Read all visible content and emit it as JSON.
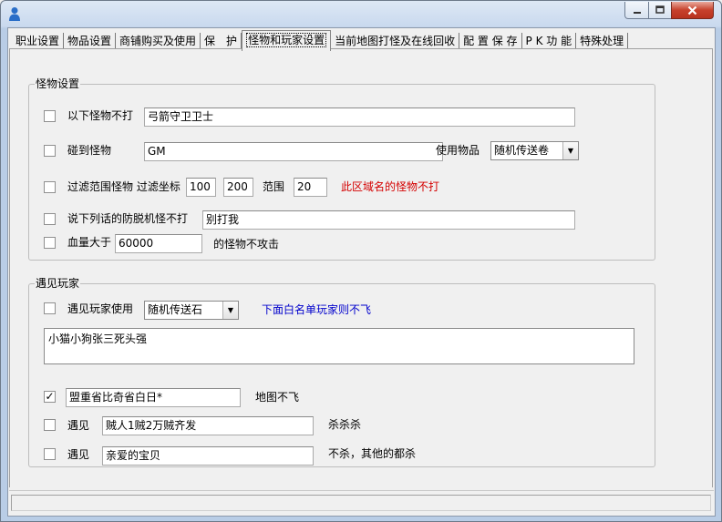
{
  "window": {
    "icons": {
      "app": "person-icon",
      "minimize": "minimize-icon",
      "maximize": "maximize-icon",
      "close": "close-icon"
    }
  },
  "tabs": [
    {
      "label": "职业设置"
    },
    {
      "label": "物品设置"
    },
    {
      "label": "商铺购买及使用"
    },
    {
      "label": "保　护"
    },
    {
      "label": "怪物和玩家设置",
      "active": true
    },
    {
      "label": "当前地图打怪及在线回收"
    },
    {
      "label": "配 置 保 存"
    },
    {
      "label": "P K 功 能"
    },
    {
      "label": "特殊处理"
    }
  ],
  "monster": {
    "title": "怪物设置",
    "no_attack": {
      "checked": false,
      "label": "以下怪物不打",
      "value": "弓箭守卫卫士"
    },
    "meet": {
      "checked": false,
      "label": "碰到怪物",
      "value": "GM",
      "use_label": "使用物品",
      "item": "随机传送卷"
    },
    "range": {
      "checked": false,
      "label": "过滤范围怪物 过滤坐标",
      "x": "100",
      "y": "200",
      "range_label": "范围",
      "range": "20",
      "note": "此区域名的怪物不打"
    },
    "talk": {
      "checked": false,
      "label": "说下列话的防脱机怪不打",
      "value": "别打我"
    },
    "hp": {
      "checked": false,
      "label": "血量大于",
      "value": "60000",
      "suffix": "的怪物不攻击"
    }
  },
  "player": {
    "title": "遇见玩家",
    "meet": {
      "checked": false,
      "label": "遇见玩家使用",
      "item": "随机传送石",
      "note": "下面白名单玩家则不飞"
    },
    "whitelist": "小猫小狗张三死头强",
    "row1": {
      "checked": true,
      "value": "盟重省比奇省白日*",
      "suffix": "地图不飞"
    },
    "row2": {
      "checked": false,
      "label": "遇见",
      "value": "贼人1贼2万贼齐发",
      "suffix": "杀杀杀"
    },
    "row3": {
      "checked": false,
      "label": "遇见",
      "value": "亲爱的宝贝",
      "suffix": "不杀，其他的都杀"
    }
  },
  "check_mark": "✓"
}
